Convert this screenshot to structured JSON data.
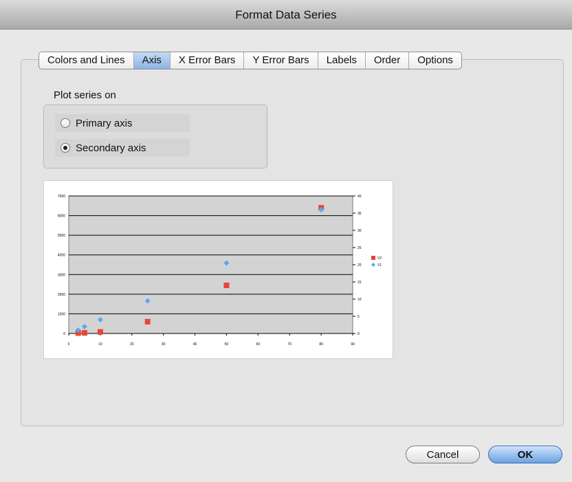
{
  "window": {
    "title": "Format Data Series"
  },
  "tabs": [
    {
      "label": "Colors and Lines",
      "active": false
    },
    {
      "label": "Axis",
      "active": true
    },
    {
      "label": "X Error Bars",
      "active": false
    },
    {
      "label": "Y Error Bars",
      "active": false
    },
    {
      "label": "Labels",
      "active": false
    },
    {
      "label": "Order",
      "active": false
    },
    {
      "label": "Options",
      "active": false
    }
  ],
  "plot_series": {
    "label": "Plot series on",
    "options": [
      {
        "label": "Primary axis",
        "selected": false
      },
      {
        "label": "Secondary axis",
        "selected": true
      }
    ]
  },
  "chart_data": {
    "type": "scatter",
    "xlim": [
      0,
      90
    ],
    "ylim": [
      0,
      7000
    ],
    "y2lim": [
      0,
      40
    ],
    "x_ticks": [
      "0",
      "10",
      "20",
      "30",
      "40",
      "50",
      "60",
      "70",
      "80",
      "90"
    ],
    "y_ticks": [
      "0",
      "1000",
      "2000",
      "3000",
      "4000",
      "5000",
      "6000",
      "7000"
    ],
    "y2_ticks": [
      "0",
      "5",
      "10",
      "15",
      "20",
      "25",
      "30",
      "35",
      "40"
    ],
    "grid": true,
    "legend_position": "right",
    "series": [
      {
        "name": "V2",
        "axis": "primary",
        "marker": "square",
        "color": "#e8443a",
        "x": [
          3,
          5,
          10,
          25,
          50,
          80
        ],
        "y": [
          20,
          30,
          80,
          600,
          2450,
          6400
        ]
      },
      {
        "name": "V1",
        "axis": "secondary",
        "marker": "diamond",
        "color": "#5aa8f0",
        "x": [
          3,
          5,
          10,
          25,
          50,
          80
        ],
        "y": [
          1,
          2,
          4,
          9.5,
          20.5,
          36
        ]
      }
    ]
  },
  "buttons": {
    "cancel": "Cancel",
    "ok": "OK"
  }
}
